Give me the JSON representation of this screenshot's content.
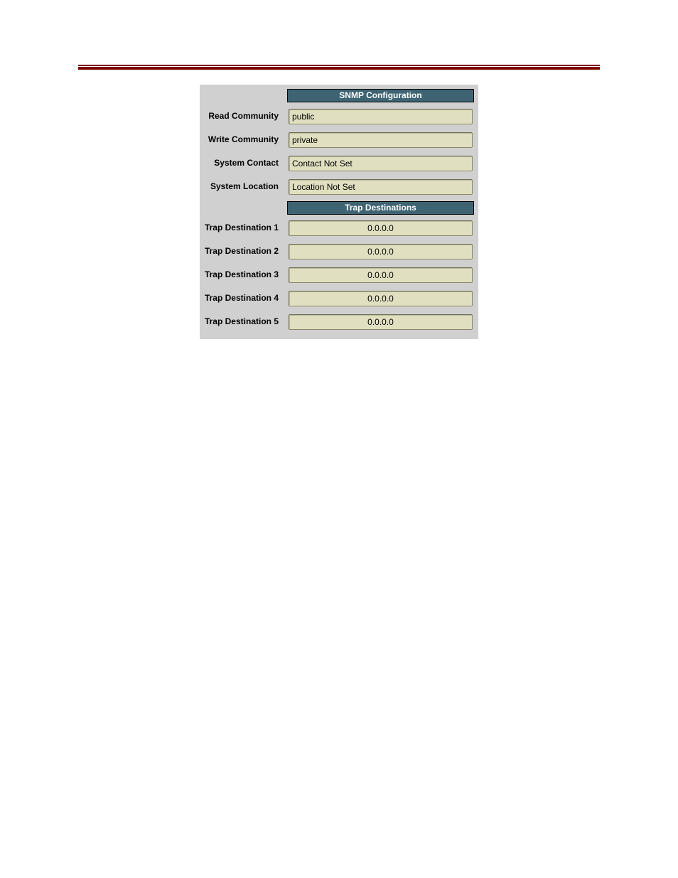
{
  "sections": {
    "snmp_header": "SNMP Configuration",
    "trap_header": "Trap Destinations"
  },
  "snmp_fields": [
    {
      "label": "Read Community",
      "value": "public"
    },
    {
      "label": "Write Community",
      "value": "private"
    },
    {
      "label": "System Contact",
      "value": "Contact Not Set"
    },
    {
      "label": "System Location",
      "value": "Location Not Set"
    }
  ],
  "trap_fields": [
    {
      "label": "Trap Destination 1",
      "value": "0.0.0.0"
    },
    {
      "label": "Trap Destination 2",
      "value": "0.0.0.0"
    },
    {
      "label": "Trap Destination 3",
      "value": "0.0.0.0"
    },
    {
      "label": "Trap Destination 4",
      "value": "0.0.0.0"
    },
    {
      "label": "Trap Destination 5",
      "value": "0.0.0.0"
    }
  ],
  "colors": {
    "rule": "#7f0000",
    "header_bg": "#3e6472",
    "panel_bg": "#d0d0d0",
    "field_bg": "#e0dfc0"
  }
}
